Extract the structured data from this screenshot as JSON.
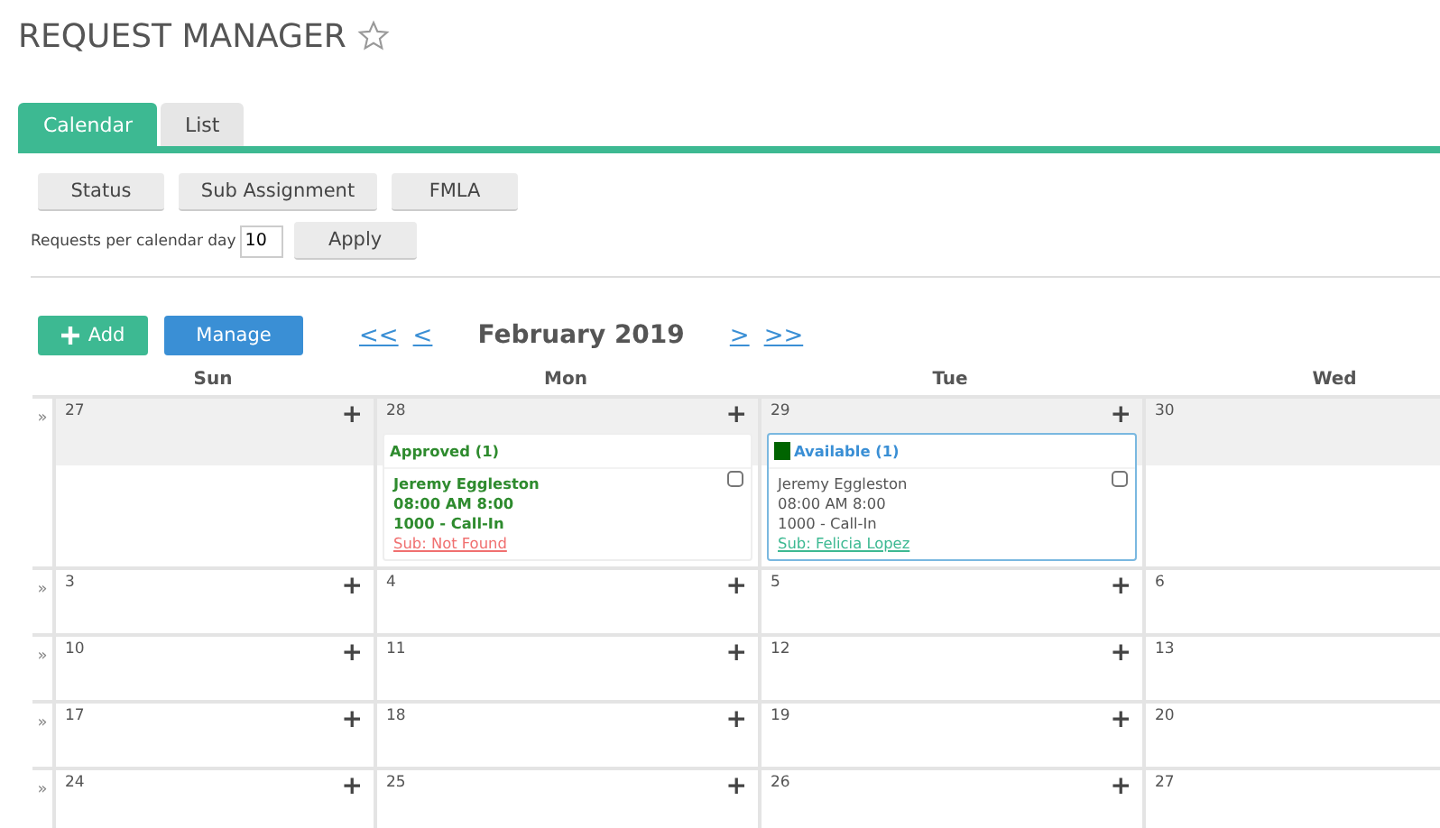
{
  "page": {
    "title": "REQUEST MANAGER",
    "favorite": false
  },
  "tabs": [
    {
      "label": "Calendar",
      "selected": true
    },
    {
      "label": "List",
      "selected": false
    }
  ],
  "filters": [
    "Status",
    "Sub Assignment",
    "FMLA"
  ],
  "requests_per_day": {
    "label": "Requests per calendar day",
    "value": "10"
  },
  "apply_button": "Apply",
  "actions": {
    "add": "Add",
    "manage": "Manage"
  },
  "nav": {
    "first": "<<",
    "prev": "<",
    "month": "February 2019",
    "next": ">",
    "last": ">>"
  },
  "weekdays": [
    "Sun",
    "Mon",
    "Tue",
    "Wed"
  ],
  "weeks": [
    {
      "marker": "»",
      "highlighted": true,
      "days": [
        {
          "date": "27",
          "add": "+"
        },
        {
          "date": "28",
          "add": "+",
          "requests": [
            {
              "kind": "approved",
              "heading": "Approved (1)",
              "checked": false,
              "employee": "Jeremy Eggleston",
              "time": "08:00 AM 8:00",
              "reason": "1000 - Call-In",
              "sub": "Sub: Not Found"
            }
          ]
        },
        {
          "date": "29",
          "add": "+",
          "requests": [
            {
              "kind": "available",
              "color": "#006400",
              "heading": "Available (1)",
              "checked": false,
              "employee": "Jeremy Eggleston",
              "time": "08:00 AM 8:00",
              "reason": "1000 - Call-In",
              "sub": "Sub: Felicia Lopez"
            }
          ]
        },
        {
          "date": "30"
        }
      ]
    },
    {
      "marker": "»",
      "highlighted": false,
      "days": [
        {
          "date": "3",
          "add": "+"
        },
        {
          "date": "4",
          "add": "+"
        },
        {
          "date": "5",
          "add": "+"
        },
        {
          "date": "6"
        }
      ]
    },
    {
      "marker": "»",
      "highlighted": false,
      "days": [
        {
          "date": "10",
          "add": "+"
        },
        {
          "date": "11",
          "add": "+"
        },
        {
          "date": "12",
          "add": "+"
        },
        {
          "date": "13"
        }
      ]
    },
    {
      "marker": "»",
      "highlighted": false,
      "days": [
        {
          "date": "17",
          "add": "+"
        },
        {
          "date": "18",
          "add": "+"
        },
        {
          "date": "19",
          "add": "+"
        },
        {
          "date": "20"
        }
      ]
    },
    {
      "marker": "»",
      "highlighted": false,
      "days": [
        {
          "date": "24",
          "add": "+"
        },
        {
          "date": "25",
          "add": "+"
        },
        {
          "date": "26",
          "add": "+"
        },
        {
          "date": "27"
        }
      ]
    }
  ]
}
